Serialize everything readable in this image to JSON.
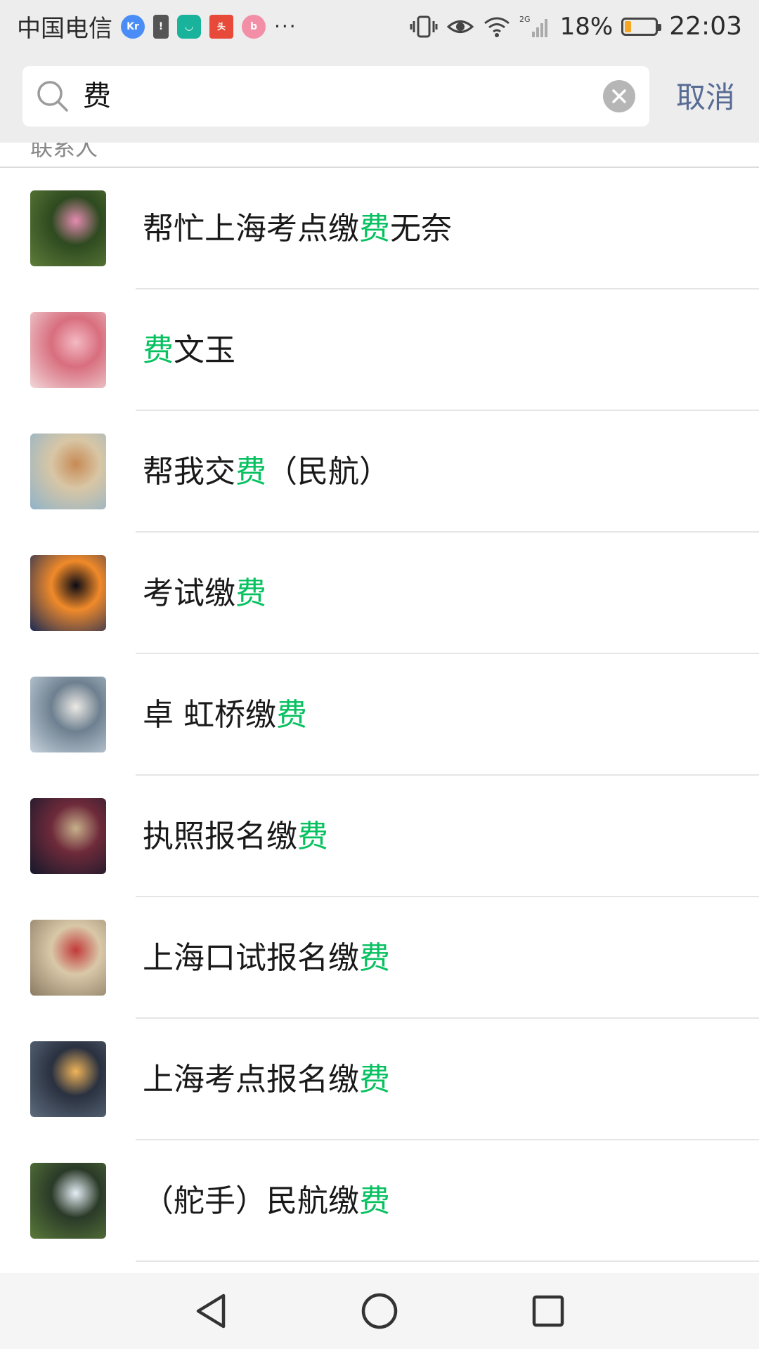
{
  "status_bar": {
    "carrier": "中国电信",
    "app_icons": [
      "36kr",
      "alert",
      "mi",
      "toutiao",
      "bilibili"
    ],
    "more": "···",
    "battery_percent": "18%",
    "time": "22:03",
    "network": "2G"
  },
  "search": {
    "query": "费",
    "cancel_label": "取消"
  },
  "section": {
    "title": "联系人"
  },
  "highlight_color": "#07c160",
  "results": [
    {
      "before": "帮忙上海考点缴",
      "match": "费",
      "after": "无奈",
      "avatar": [
        "#5f7d3a",
        "#2e4a20",
        "#e58bb1"
      ]
    },
    {
      "before": "",
      "match": "费",
      "after": "文玉",
      "avatar": [
        "#f1d7d9",
        "#d86e7e",
        "#f3b9c2"
      ]
    },
    {
      "before": "帮我交",
      "match": "费",
      "after": "（民航）",
      "avatar": [
        "#8fb3c9",
        "#d8c6a5",
        "#c78a55"
      ]
    },
    {
      "before": "考试缴",
      "match": "费",
      "after": "",
      "avatar": [
        "#1a2a55",
        "#f08a2a",
        "#0b0b14"
      ]
    },
    {
      "before": "卓 虹桥缴",
      "match": "费",
      "after": "",
      "avatar": [
        "#c7d3de",
        "#6e8090",
        "#ece9e4"
      ]
    },
    {
      "before": "执照报名缴",
      "match": "费",
      "after": "",
      "avatar": [
        "#14182a",
        "#6e2a3a",
        "#c7b08a"
      ]
    },
    {
      "before": "上海口试报名缴",
      "match": "费",
      "after": "",
      "avatar": [
        "#8a7a62",
        "#d9c8a8",
        "#c23a3a"
      ]
    },
    {
      "before": "上海考点报名缴",
      "match": "费",
      "after": "",
      "avatar": [
        "#5d6c7d",
        "#2a3140",
        "#f0b45a"
      ]
    },
    {
      "before": "（舵手）民航缴",
      "match": "费",
      "after": "",
      "avatar": [
        "#5a7a3a",
        "#2a3a28",
        "#e6eef7"
      ]
    }
  ],
  "nav": {
    "back": "back-triangle",
    "home": "home-circle",
    "recents": "recents-square"
  }
}
